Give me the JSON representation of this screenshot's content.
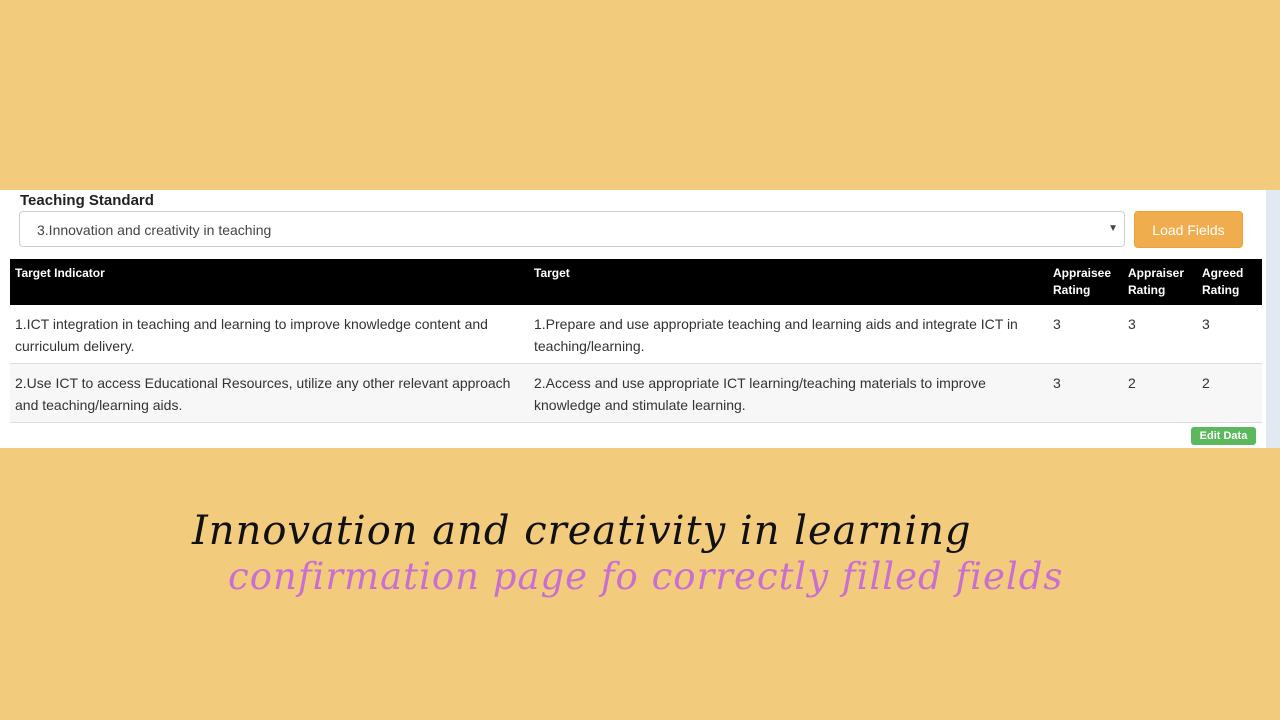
{
  "form": {
    "label": "Teaching Standard",
    "select_value": "3.Innovation and creativity in teaching",
    "load_button": "Load Fields",
    "edit_button": "Edit Data"
  },
  "table": {
    "headers": [
      "Target Indicator",
      "Target",
      "Appraisee Rating",
      "Appraiser Rating",
      "Agreed Rating"
    ],
    "rows": [
      [
        "1.ICT integration in teaching and learning to improve knowledge content and curriculum delivery.",
        "1.Prepare and use appropriate teaching and learning aids and integrate ICT in teaching/learning.",
        "3",
        "3",
        "3"
      ],
      [
        "2.Use ICT to access Educational Resources, utilize any other relevant approach and teaching/learning aids.",
        "2.Access and use appropriate ICT learning/teaching materials to improve knowledge and stimulate learning.",
        "3",
        "2",
        "2"
      ]
    ]
  },
  "caption": {
    "line1": "Innovation and creativity in learning",
    "line2": "confirmation page fo correctly filled fields"
  },
  "colors": {
    "background": "#f2cb7d",
    "load_button": "#f0ad4e",
    "edit_button": "#5cb85c",
    "caption_accent": "#c86fd1"
  }
}
